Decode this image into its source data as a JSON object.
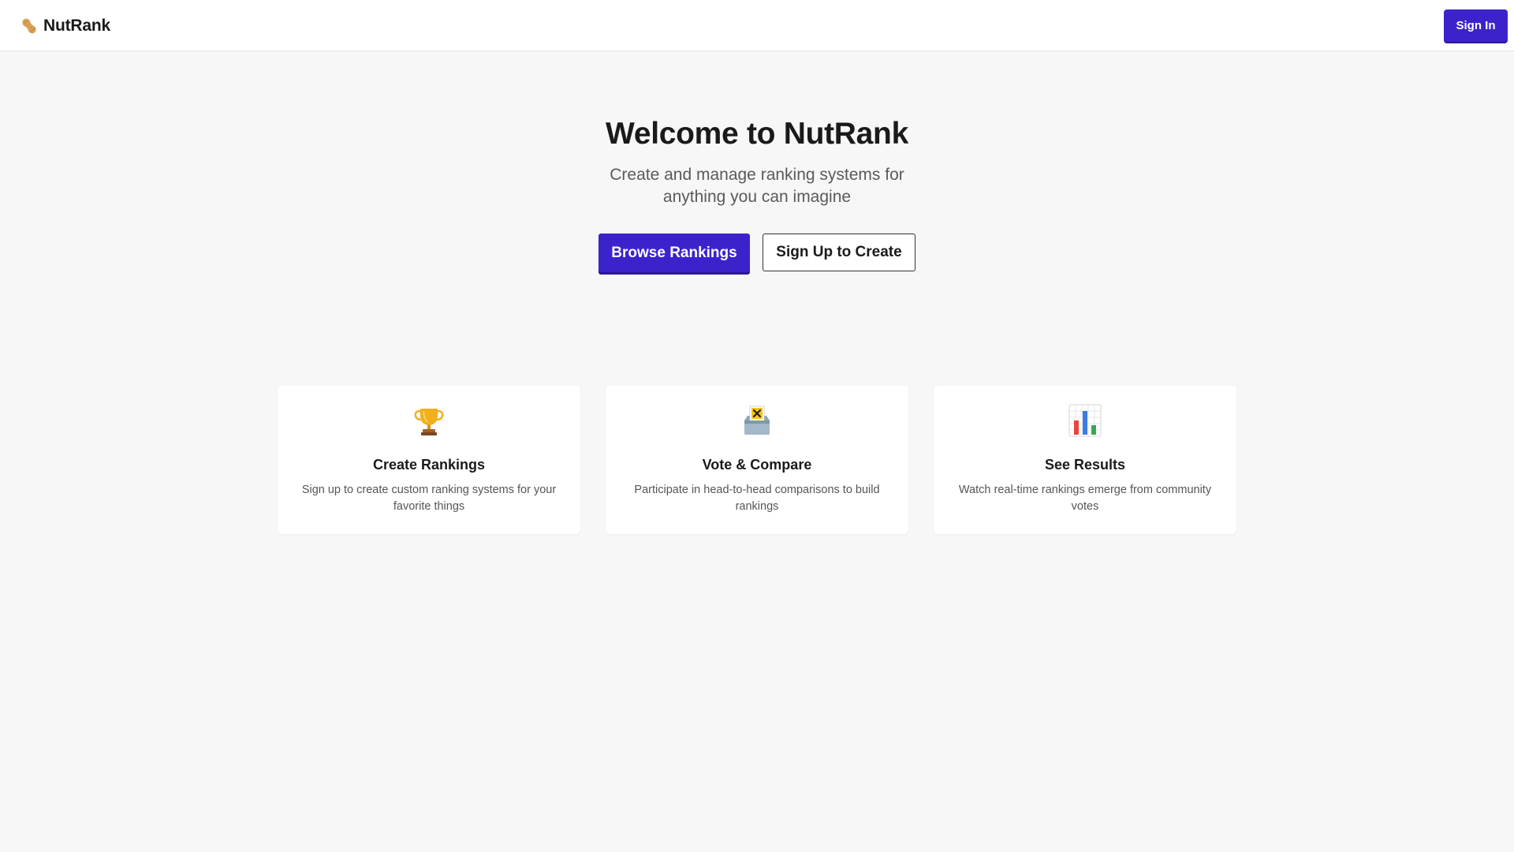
{
  "header": {
    "logo_icon": "peanut-icon",
    "logo_text": "NutRank",
    "sign_in_label": "Sign In"
  },
  "hero": {
    "title": "Welcome to NutRank",
    "subtitle": "Create and manage ranking systems for anything you can imagine",
    "primary_button_label": "Browse Rankings",
    "secondary_button_label": "Sign Up to Create"
  },
  "features": [
    {
      "icon": "trophy-icon",
      "title": "Create Rankings",
      "description": "Sign up to create custom ranking systems for your favorite things"
    },
    {
      "icon": "ballot-box-icon",
      "title": "Vote & Compare",
      "description": "Participate in head-to-head comparisons to build rankings"
    },
    {
      "icon": "bar-chart-icon",
      "title": "See Results",
      "description": "Watch real-time rankings emerge from community votes"
    }
  ],
  "colors": {
    "accent": "#3b23cc",
    "background": "#f7f7f7",
    "card_background": "#ffffff"
  }
}
